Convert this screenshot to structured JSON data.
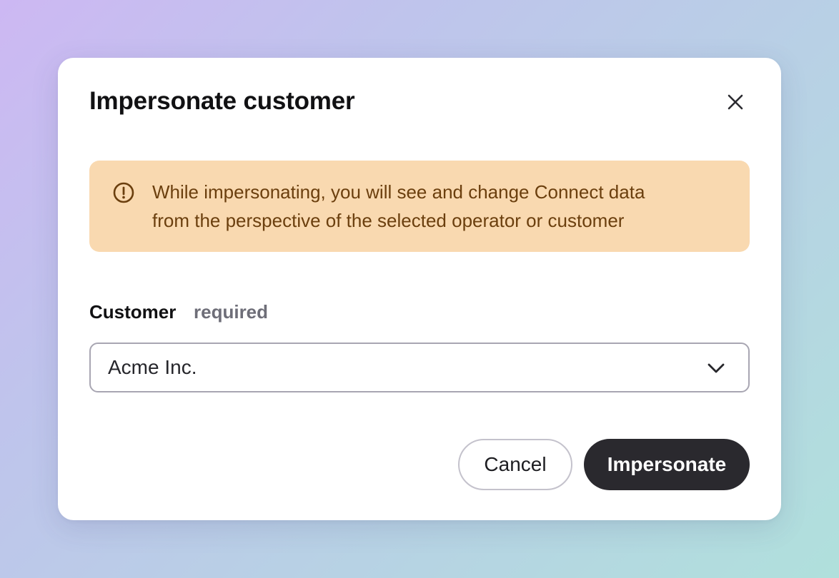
{
  "dialog": {
    "title": "Impersonate customer",
    "close_icon": "close-icon"
  },
  "alert": {
    "icon": "alert-circle-icon",
    "line1": "While impersonating, you will see and change Connect data",
    "line2": "from the perspective of the selected operator or customer"
  },
  "customer_field": {
    "label": "Customer",
    "hint": "required",
    "selected_value": "Acme Inc.",
    "chevron_icon": "chevron-down-icon"
  },
  "actions": {
    "cancel_label": "Cancel",
    "primary_label": "Impersonate"
  },
  "colors": {
    "alert_background": "#f9d9b0",
    "alert_text": "#6b3f0e",
    "primary_button": "#2a292e"
  }
}
